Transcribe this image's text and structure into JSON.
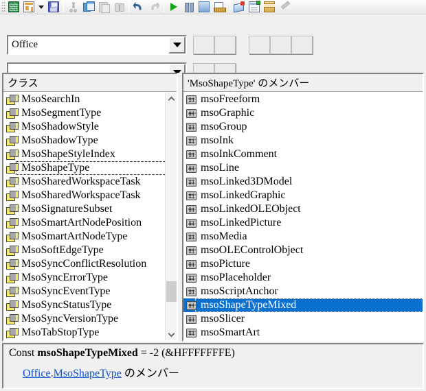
{
  "toolbar": {
    "buttons": [
      {
        "name": "view-microsoft-excel-icon",
        "title": "Microsoft Excel の表示"
      },
      {
        "name": "insert-userform-icon",
        "title": "ユーザー フォームの挿入"
      },
      {
        "name": "insert-dropdown-icon",
        "title": "挿入メニュー"
      },
      {
        "name": "save-icon",
        "title": "上書き保存"
      },
      {
        "name": "cut-icon",
        "title": "切り取り"
      },
      {
        "name": "copy-icon",
        "title": "コピー"
      },
      {
        "name": "paste-icon",
        "title": "貼り付け"
      },
      {
        "name": "find-icon",
        "title": "検索"
      },
      {
        "name": "undo-icon",
        "title": "元に戻す"
      },
      {
        "name": "redo-icon",
        "title": "やり直し"
      },
      {
        "name": "run-icon",
        "title": "Sub/ユーザー フォームの実行"
      },
      {
        "name": "break-icon",
        "title": "中断"
      },
      {
        "name": "reset-icon",
        "title": "リセット"
      },
      {
        "name": "design-mode-icon",
        "title": "デザイン モード"
      },
      {
        "name": "project-explorer-icon",
        "title": "プロジェクト エクスプローラー"
      },
      {
        "name": "properties-window-icon",
        "title": "プロパティ ウィンドウ"
      },
      {
        "name": "object-browser-icon",
        "title": "オブジェクト ブラウザー"
      },
      {
        "name": "toolbox-icon",
        "title": "ツールボックス"
      }
    ]
  },
  "library_combo": {
    "value": "Office",
    "dropdown_icon": "chevron-down-icon"
  },
  "search_combo": {
    "value": "",
    "placeholder": "",
    "dropdown_icon": "chevron-down-icon"
  },
  "toolbar_buttons_row1": [
    "",
    "",
    "",
    "",
    ""
  ],
  "toolbar_buttons_row2": [
    "",
    ""
  ],
  "classes_pane": {
    "header": "クラス",
    "items": [
      {
        "label": "MsoSearchIn",
        "icon": "enum-icon"
      },
      {
        "label": "MsoSegmentType",
        "icon": "enum-icon"
      },
      {
        "label": "MsoShadowStyle",
        "icon": "enum-icon"
      },
      {
        "label": "MsoShadowType",
        "icon": "enum-icon"
      },
      {
        "label": "MsoShapeStyleIndex",
        "icon": "enum-icon"
      },
      {
        "label": "MsoShapeType",
        "icon": "enum-icon",
        "focused": true
      },
      {
        "label": "MsoSharedWorkspaceTask",
        "icon": "enum-icon"
      },
      {
        "label": "MsoSharedWorkspaceTask",
        "icon": "enum-icon"
      },
      {
        "label": "MsoSignatureSubset",
        "icon": "enum-icon"
      },
      {
        "label": "MsoSmartArtNodePosition",
        "icon": "enum-icon"
      },
      {
        "label": "MsoSmartArtNodeType",
        "icon": "enum-icon"
      },
      {
        "label": "MsoSoftEdgeType",
        "icon": "enum-icon"
      },
      {
        "label": "MsoSyncConflictResolution",
        "icon": "enum-icon"
      },
      {
        "label": "MsoSyncErrorType",
        "icon": "enum-icon"
      },
      {
        "label": "MsoSyncEventType",
        "icon": "enum-icon"
      },
      {
        "label": "MsoSyncStatusType",
        "icon": "enum-icon"
      },
      {
        "label": "MsoSyncVersionType",
        "icon": "enum-icon"
      },
      {
        "label": "MsoTabStopType",
        "icon": "enum-icon"
      }
    ],
    "scrollbar": {
      "up_icon": "chevron-up-icon",
      "down_icon": "chevron-down-icon",
      "thumb_top_pct": 78,
      "thumb_height_pct": 9
    }
  },
  "members_pane": {
    "header": "'MsoShapeType' のメンバー",
    "items": [
      {
        "label": "msoFreeform",
        "icon": "constant-icon"
      },
      {
        "label": "msoGraphic",
        "icon": "constant-icon"
      },
      {
        "label": "msoGroup",
        "icon": "constant-icon"
      },
      {
        "label": "msoInk",
        "icon": "constant-icon"
      },
      {
        "label": "msoInkComment",
        "icon": "constant-icon"
      },
      {
        "label": "msoLine",
        "icon": "constant-icon"
      },
      {
        "label": "msoLinked3DModel",
        "icon": "constant-icon"
      },
      {
        "label": "msoLinkedGraphic",
        "icon": "constant-icon"
      },
      {
        "label": "msoLinkedOLEObject",
        "icon": "constant-icon"
      },
      {
        "label": "msoLinkedPicture",
        "icon": "constant-icon"
      },
      {
        "label": "msoMedia",
        "icon": "constant-icon"
      },
      {
        "label": "msoOLEControlObject",
        "icon": "constant-icon"
      },
      {
        "label": "msoPicture",
        "icon": "constant-icon"
      },
      {
        "label": "msoPlaceholder",
        "icon": "constant-icon"
      },
      {
        "label": "msoScriptAnchor",
        "icon": "constant-icon"
      },
      {
        "label": "msoShapeTypeMixed",
        "icon": "constant-icon",
        "selected": true
      },
      {
        "label": "msoSlicer",
        "icon": "constant-icon"
      },
      {
        "label": "msoSmartArt",
        "icon": "constant-icon"
      }
    ]
  },
  "detail": {
    "keyword": "Const",
    "member_name": "msoShapeTypeMixed",
    "equals": "=",
    "value": "-2",
    "hex": "(&HFFFFFFFE)",
    "parent_link": "Office",
    "separator": ".",
    "member_link": "MsoShapeType",
    "suffix": "のメンバー"
  },
  "colors": {
    "selection": "#0a71d0",
    "link": "#0a56c8",
    "window": "#f0f0f0",
    "list_bg": "#ffffff"
  }
}
